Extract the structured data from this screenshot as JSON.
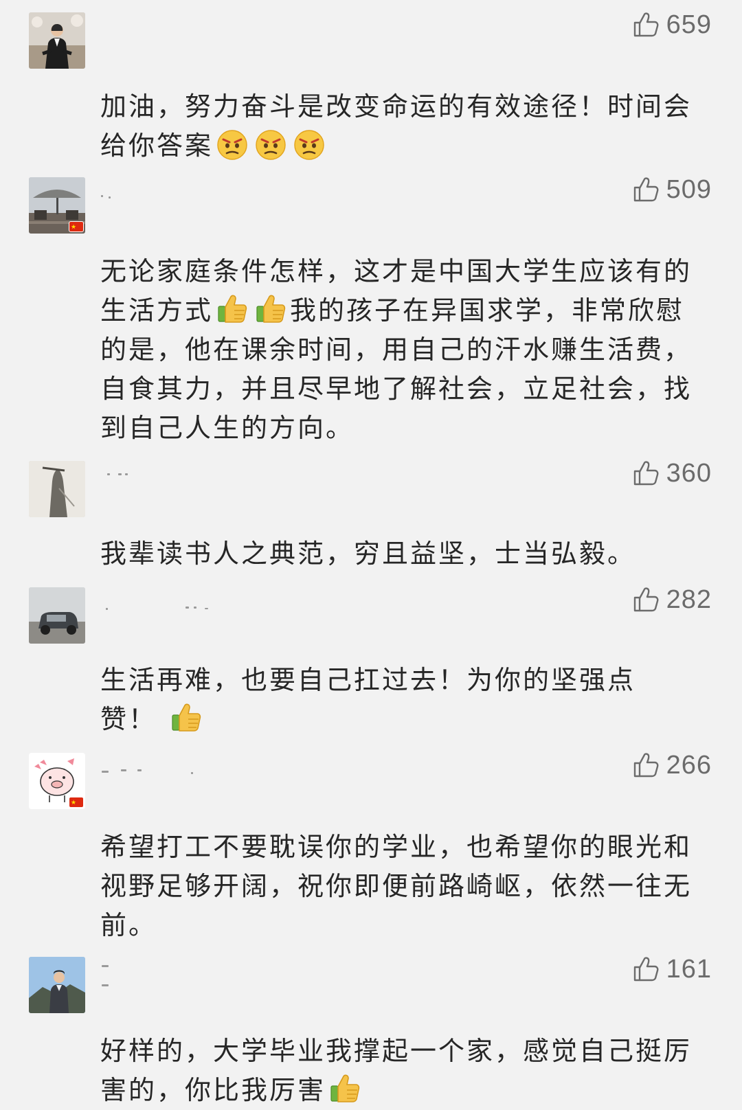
{
  "comments": [
    {
      "likes": "659",
      "text": "加油，努力奋斗是改变命运的有效途径！时间会给你答案",
      "emoji_count": 3,
      "emoji": "angry-face-icon",
      "has_flag": false
    },
    {
      "likes": "509",
      "text_a": "无论家庭条件怎样，这才是中国大学生应该有的生活方式",
      "text_b": "我的孩子在异国求学，非常欣慰的是，他在课余时间，用自己的汗水赚生活费，自食其力，并且尽早地了解社会，立足社会，找到自己人生的方向。",
      "emoji": "thumbs-up-icon",
      "has_flag": true
    },
    {
      "likes": "360",
      "text": "我辈读书人之典范，穷且益坚，士当弘毅。",
      "has_flag": false
    },
    {
      "likes": "282",
      "text": "生活再难，也要自己扛过去！为你的坚强点赞！",
      "emoji": "thumbs-up-icon",
      "has_flag": false
    },
    {
      "likes": "266",
      "text": "希望打工不要耽误你的学业，也希望你的眼光和视野足够开阔，祝你即便前路崎岖，依然一往无前。",
      "has_flag": true
    },
    {
      "likes": "161",
      "text": "好样的，大学毕业我撑起一个家，感觉自己挺厉害的，你比我厉害",
      "emoji": "thumbs-up-icon",
      "has_flag": false
    }
  ],
  "colors": {
    "background": "#f2f2f2",
    "text": "#262626",
    "like": "#6b6b6b",
    "flag": "#de2910"
  }
}
